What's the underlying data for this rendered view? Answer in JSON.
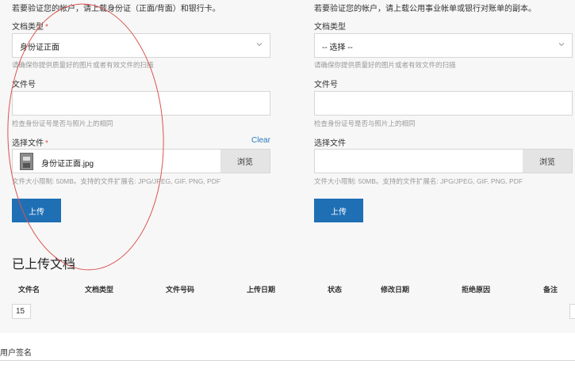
{
  "left": {
    "intro": "若要验证您的帐户，请上载身份证（正面/背面）和银行卡。",
    "doc_type_label": "文档类型",
    "required_mark": "*",
    "doc_type_value": "身份证正面",
    "doc_type_hint": "请确保你提供质量好的图片或者有效文件的扫描",
    "file_no_label": "文件号",
    "file_no_value": "",
    "file_no_hint": "检查身份证号是否与照片上的相同",
    "choose_file_label": "选择文件",
    "clear_label": "Clear",
    "file_name": "身份证正面.jpg",
    "browse_label": "浏览",
    "file_hint": "文件大小限制: 50MB。支持的文件扩展名: JPG/JPEG, GIF, PNG, PDF",
    "upload_label": "上传"
  },
  "right": {
    "intro": "若要验证您的帐户，请上载公用事业帐单或银行对账单的副本。",
    "doc_type_label": "文档类型",
    "doc_type_value": "-- 选择 --",
    "doc_type_hint": "请确保你提供质量好的图片或者有效文件的扫描",
    "file_no_label": "文件号",
    "file_no_value": "",
    "file_no_hint": "检查身份证号是否与照片上的相同",
    "choose_file_label": "选择文件",
    "file_name": "",
    "browse_label": "浏览",
    "file_hint": "文件大小限制: 50MB。支持的文件扩展名: JPG/JPEG, GIF, PNG, PDF",
    "upload_label": "上传"
  },
  "uploaded": {
    "title": "已上传文档",
    "columns": [
      "文件名",
      "文档类型",
      "文件号码",
      "上传日期",
      "状态",
      "修改日期",
      "拒绝原因",
      "备注"
    ],
    "page_size": "15"
  },
  "signature_label": "用户签名",
  "colors": {
    "primary": "#1f6fb5",
    "annotation": "#d9534f",
    "link": "#2a7bc0"
  },
  "icons": {
    "select_arrow": "chevron-down-icon",
    "file_thumb": "image-file-icon"
  }
}
